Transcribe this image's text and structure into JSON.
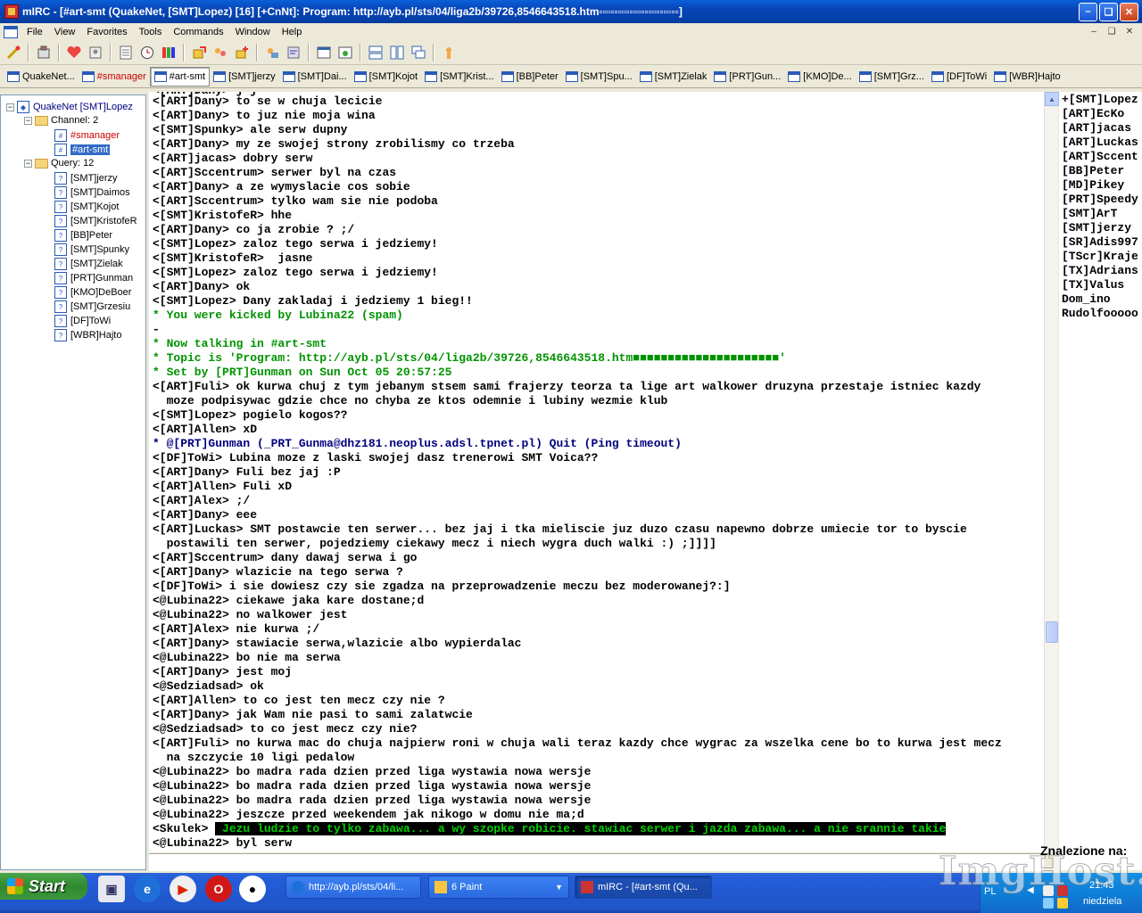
{
  "window": {
    "title": "mIRC - [#art-smt (QuakeNet, [SMT]Lopez) [16] [+CnNt]: Program: http://ayb.pl/sts/04/liga2b/39726,8546643518.htm▫▫▫▫▫▫▫▫▫▫▫▫▫▫▫▫▫▫▫▫▫]",
    "minimize": "–",
    "maximize": "❏",
    "close": "✕"
  },
  "menu": [
    "File",
    "View",
    "Favorites",
    "Tools",
    "Commands",
    "Window",
    "Help"
  ],
  "mdi_buttons": [
    "–",
    "❏",
    "✕"
  ],
  "toolbar_icons": [
    "connect-icon",
    "options-icon",
    "favorites-icon",
    "address-book-icon",
    "channel-list-icon",
    "timer-icon",
    "colors-icon",
    "send-file-icon",
    "dcc-chat-icon",
    "file-server-icon",
    "notify-list-icon",
    "log-viewer-icon",
    "scripts-icon",
    "urls-icon",
    "tile-horizontal-icon",
    "tile-vertical-icon",
    "cascade-icon",
    "help-icon"
  ],
  "switchbar": [
    {
      "label": "QuakeNet...",
      "kind": "server"
    },
    {
      "label": "#smanager",
      "kind": "channel"
    },
    {
      "label": "#art-smt",
      "kind": "active"
    },
    {
      "label": "[SMT]jerzy",
      "kind": "query"
    },
    {
      "label": "[SMT]Dai...",
      "kind": "query"
    },
    {
      "label": "[SMT]Kojot",
      "kind": "query"
    },
    {
      "label": "[SMT]Krist...",
      "kind": "query"
    },
    {
      "label": "[BB]Peter",
      "kind": "query"
    },
    {
      "label": "[SMT]Spu...",
      "kind": "query"
    },
    {
      "label": "[SMT]Zielak",
      "kind": "query"
    },
    {
      "label": "[PRT]Gun...",
      "kind": "query"
    },
    {
      "label": "[KMO]De...",
      "kind": "query"
    },
    {
      "label": "[SMT]Grz...",
      "kind": "query"
    },
    {
      "label": "[DF]ToWi",
      "kind": "query"
    },
    {
      "label": "[WBR]Hajto",
      "kind": "query"
    }
  ],
  "tree": {
    "server": "QuakeNet [SMT]Lopez",
    "channel_folder": "Channel: 2",
    "channels": [
      "#smanager",
      "#art-smt"
    ],
    "query_folder": "Query: 12",
    "queries": [
      "[SMT]jerzy",
      "[SMT]Daimos",
      "[SMT]Kojot",
      "[SMT]KristofeR",
      "[BB]Peter",
      "[SMT]Spunky",
      "[SMT]Zielak",
      "[PRT]Gunman",
      "[KMO]DeBoer",
      "[SMT]Grzesiu",
      "[DF]ToWi",
      "[WBR]Hajto"
    ]
  },
  "chat": [
    {
      "text": "<[ART]Dany> to se w chuja lecicie",
      "style": "normal"
    },
    {
      "text": "<[ART]Dany> to juz nie moja wina",
      "style": "normal"
    },
    {
      "text": "<[SMT]Spunky> ale serw dupny",
      "style": "normal"
    },
    {
      "text": "<[ART]Dany> my ze swojej strony zrobilismy co trzeba",
      "style": "normal"
    },
    {
      "text": "<[ART]jacas> dobry serw",
      "style": "normal"
    },
    {
      "text": "<[ART]Sccentrum> serwer byl na czas",
      "style": "normal"
    },
    {
      "text": "<[ART]Dany> a ze wymyslacie cos sobie",
      "style": "normal"
    },
    {
      "text": "<[ART]Sccentrum> tylko wam sie nie podoba",
      "style": "normal"
    },
    {
      "text": "<[SMT]KristofeR> hhe",
      "style": "normal"
    },
    {
      "text": "<[ART]Dany> co ja zrobie ? ;/",
      "style": "normal"
    },
    {
      "text": "<[SMT]Lopez> zaloz tego serwa i jedziemy!",
      "style": "normal"
    },
    {
      "text": "<[SMT]KristofeR>  jasne",
      "style": "normal"
    },
    {
      "text": "<[SMT]Lopez> zaloz tego serwa i jedziemy!",
      "style": "normal"
    },
    {
      "text": "<[ART]Dany> ok",
      "style": "normal"
    },
    {
      "text": "<[SMT]Lopez> Dany zakladaj i jedziemy 1 bieg!!",
      "style": "normal"
    },
    {
      "text": "* You were kicked by Lubina22 (spam)",
      "style": "green"
    },
    {
      "text": "-",
      "style": "normal"
    },
    {
      "text": "* Now talking in #art-smt",
      "style": "green"
    },
    {
      "text": "* Topic is 'Program: http://ayb.pl/sts/04/liga2b/39726,8546643518.htm■■■■■■■■■■■■■■■■■■■■■'",
      "style": "green"
    },
    {
      "text": "* Set by [PRT]Gunman on Sun Oct 05 20:57:25",
      "style": "green"
    },
    {
      "text": "<[ART]Fuli> ok kurwa chuj z tym jebanym stsem sami frajerzy teorza ta lige art walkower druzyna przestaje istniec kazdy",
      "style": "normal"
    },
    {
      "text": "  moze podpisywac gdzie chce no chyba ze ktos odemnie i lubiny wezmie klub",
      "style": "normal"
    },
    {
      "text": "<[SMT]Lopez> pogielo kogos??",
      "style": "normal"
    },
    {
      "text": "<[ART]Allen> xD",
      "style": "normal"
    },
    {
      "text": "* @[PRT]Gunman (_PRT_Gunma@dhz181.neoplus.adsl.tpnet.pl) Quit (Ping timeout)",
      "style": "blue"
    },
    {
      "text": "<[DF]ToWi> Lubina moze z laski swojej dasz trenerowi SMT Voica??",
      "style": "normal"
    },
    {
      "text": "<[ART]Dany> Fuli bez jaj :P",
      "style": "normal"
    },
    {
      "text": "<[ART]Allen> Fuli xD",
      "style": "normal"
    },
    {
      "text": "<[ART]Alex> ;/",
      "style": "normal"
    },
    {
      "text": "<[ART]Dany> eee",
      "style": "normal"
    },
    {
      "text": "<[ART]Luckas> SMT postawcie ten serwer... bez jaj i tka mieliscie juz duzo czasu napewno dobrze umiecie tor to byscie",
      "style": "normal"
    },
    {
      "text": "  postawili ten serwer, pojedziemy ciekawy mecz i niech wygra duch walki :) ;]]]]",
      "style": "normal"
    },
    {
      "text": "<[ART]Sccentrum> dany dawaj serwa i go",
      "style": "normal"
    },
    {
      "text": "<[ART]Dany> wlazicie na tego serwa ?",
      "style": "normal"
    },
    {
      "text": "<[DF]ToWi> i sie dowiesz czy sie zgadza na przeprowadzenie meczu bez moderowanej?:]",
      "style": "normal"
    },
    {
      "text": "<@Lubina22> ciekawe jaka kare dostane;d",
      "style": "normal"
    },
    {
      "text": "<@Lubina22> no walkower jest",
      "style": "normal"
    },
    {
      "text": "<[ART]Alex> nie kurwa ;/",
      "style": "normal"
    },
    {
      "text": "<[ART]Dany> stawiacie serwa,wlazicie albo wypierdalac",
      "style": "normal"
    },
    {
      "text": "<@Lubina22> bo nie ma serwa",
      "style": "normal"
    },
    {
      "text": "<[ART]Dany> jest moj",
      "style": "normal"
    },
    {
      "text": "<@Sedziadsad> ok",
      "style": "normal"
    },
    {
      "text": "<[ART]Allen> to co jest ten mecz czy nie ?",
      "style": "normal"
    },
    {
      "text": "<[ART]Dany> jak Wam nie pasi to sami zalatwcie",
      "style": "normal"
    },
    {
      "text": "<@Sedziadsad> to co jest mecz czy nie?",
      "style": "normal"
    },
    {
      "text": "<[ART]Fuli> no kurwa mac do chuja najpierw roni w chuja wali teraz kazdy chce wygrac za wszelka cene bo to kurwa jest mecz",
      "style": "normal"
    },
    {
      "text": "  na szczycie 10 ligi pedalow",
      "style": "normal"
    },
    {
      "text": "<@Lubina22> bo madra rada dzien przed liga wystawia nowa wersje",
      "style": "normal"
    },
    {
      "text": "<@Lubina22> bo madra rada dzien przed liga wystawia nowa wersje",
      "style": "normal"
    },
    {
      "text": "<@Lubina22> bo madra rada dzien przed liga wystawia nowa wersje",
      "style": "normal"
    },
    {
      "text": "<@Lubina22> jeszcze przed weekendem jak nikogo w domu nie ma;d",
      "style": "normal"
    }
  ],
  "highlight_line": {
    "nick": "<Skulek> ",
    "message": " Jezu ludzie to tylko zabawa... a wy szopke robicie. stawiac serwer i jazda zabawa... a nie srannie takie"
  },
  "last_line": "<@Lubina22> byl serw",
  "input": {
    "value": ""
  },
  "nicks": [
    "+[SMT]Lopez",
    "[ART]EcKo",
    "[ART]jacas",
    "[ART]Luckas",
    "[ART]Sccent",
    "[BB]Peter",
    "[MD]Pikey",
    "[PRT]Speedy",
    "[SMT]ArT",
    "[SMT]jerzy",
    "[SR]Adis997",
    "[TScr]Kraje",
    "[TX]Adrians",
    "[TX]Valus",
    "Dom_ino",
    "Rudolfooooo"
  ],
  "find_label": "Znalezione na:",
  "taskbar": {
    "start": "Start",
    "tasks": [
      "http://ayb.pl/sts/04/li...",
      "6 Paint",
      "mIRC - [#art-smt (Qu..."
    ],
    "tray_lang": "PL",
    "clock": "21:43",
    "day": "niedziela"
  },
  "watermark": "ImgHost.pl",
  "colors": {
    "green_text": "#009300",
    "blue_text": "#00007f",
    "highlight_bg": "#000000",
    "highlight_fg": "#00d000",
    "titlebar": "#0845b8"
  }
}
